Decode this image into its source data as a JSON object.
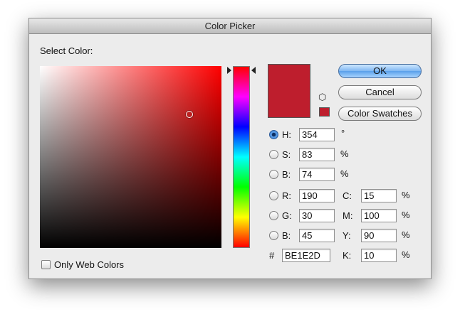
{
  "window": {
    "title": "Color Picker"
  },
  "select_color_label": "Select Color:",
  "current_color_hex": "#BE1E2D",
  "previous_color_hex": "#BE1E2D",
  "buttons": {
    "ok": "OK",
    "cancel": "Cancel",
    "swatches": "Color Swatches"
  },
  "hsb": {
    "h": {
      "label": "H:",
      "value": "354",
      "unit": "°"
    },
    "s": {
      "label": "S:",
      "value": "83",
      "unit": "%"
    },
    "b": {
      "label": "B:",
      "value": "74",
      "unit": "%"
    }
  },
  "rgb": {
    "r": {
      "label": "R:",
      "value": "190"
    },
    "g": {
      "label": "G:",
      "value": "30"
    },
    "b": {
      "label": "B:",
      "value": "45"
    }
  },
  "cmyk": {
    "c": {
      "label": "C:",
      "value": "15",
      "unit": "%"
    },
    "m": {
      "label": "M:",
      "value": "100",
      "unit": "%"
    },
    "y": {
      "label": "Y:",
      "value": "90",
      "unit": "%"
    },
    "k": {
      "label": "K:",
      "value": "10",
      "unit": "%"
    }
  },
  "hex": {
    "label": "#",
    "value": "BE1E2D"
  },
  "only_web_colors": {
    "label": "Only Web Colors",
    "checked": false
  },
  "selected_mode": "H"
}
